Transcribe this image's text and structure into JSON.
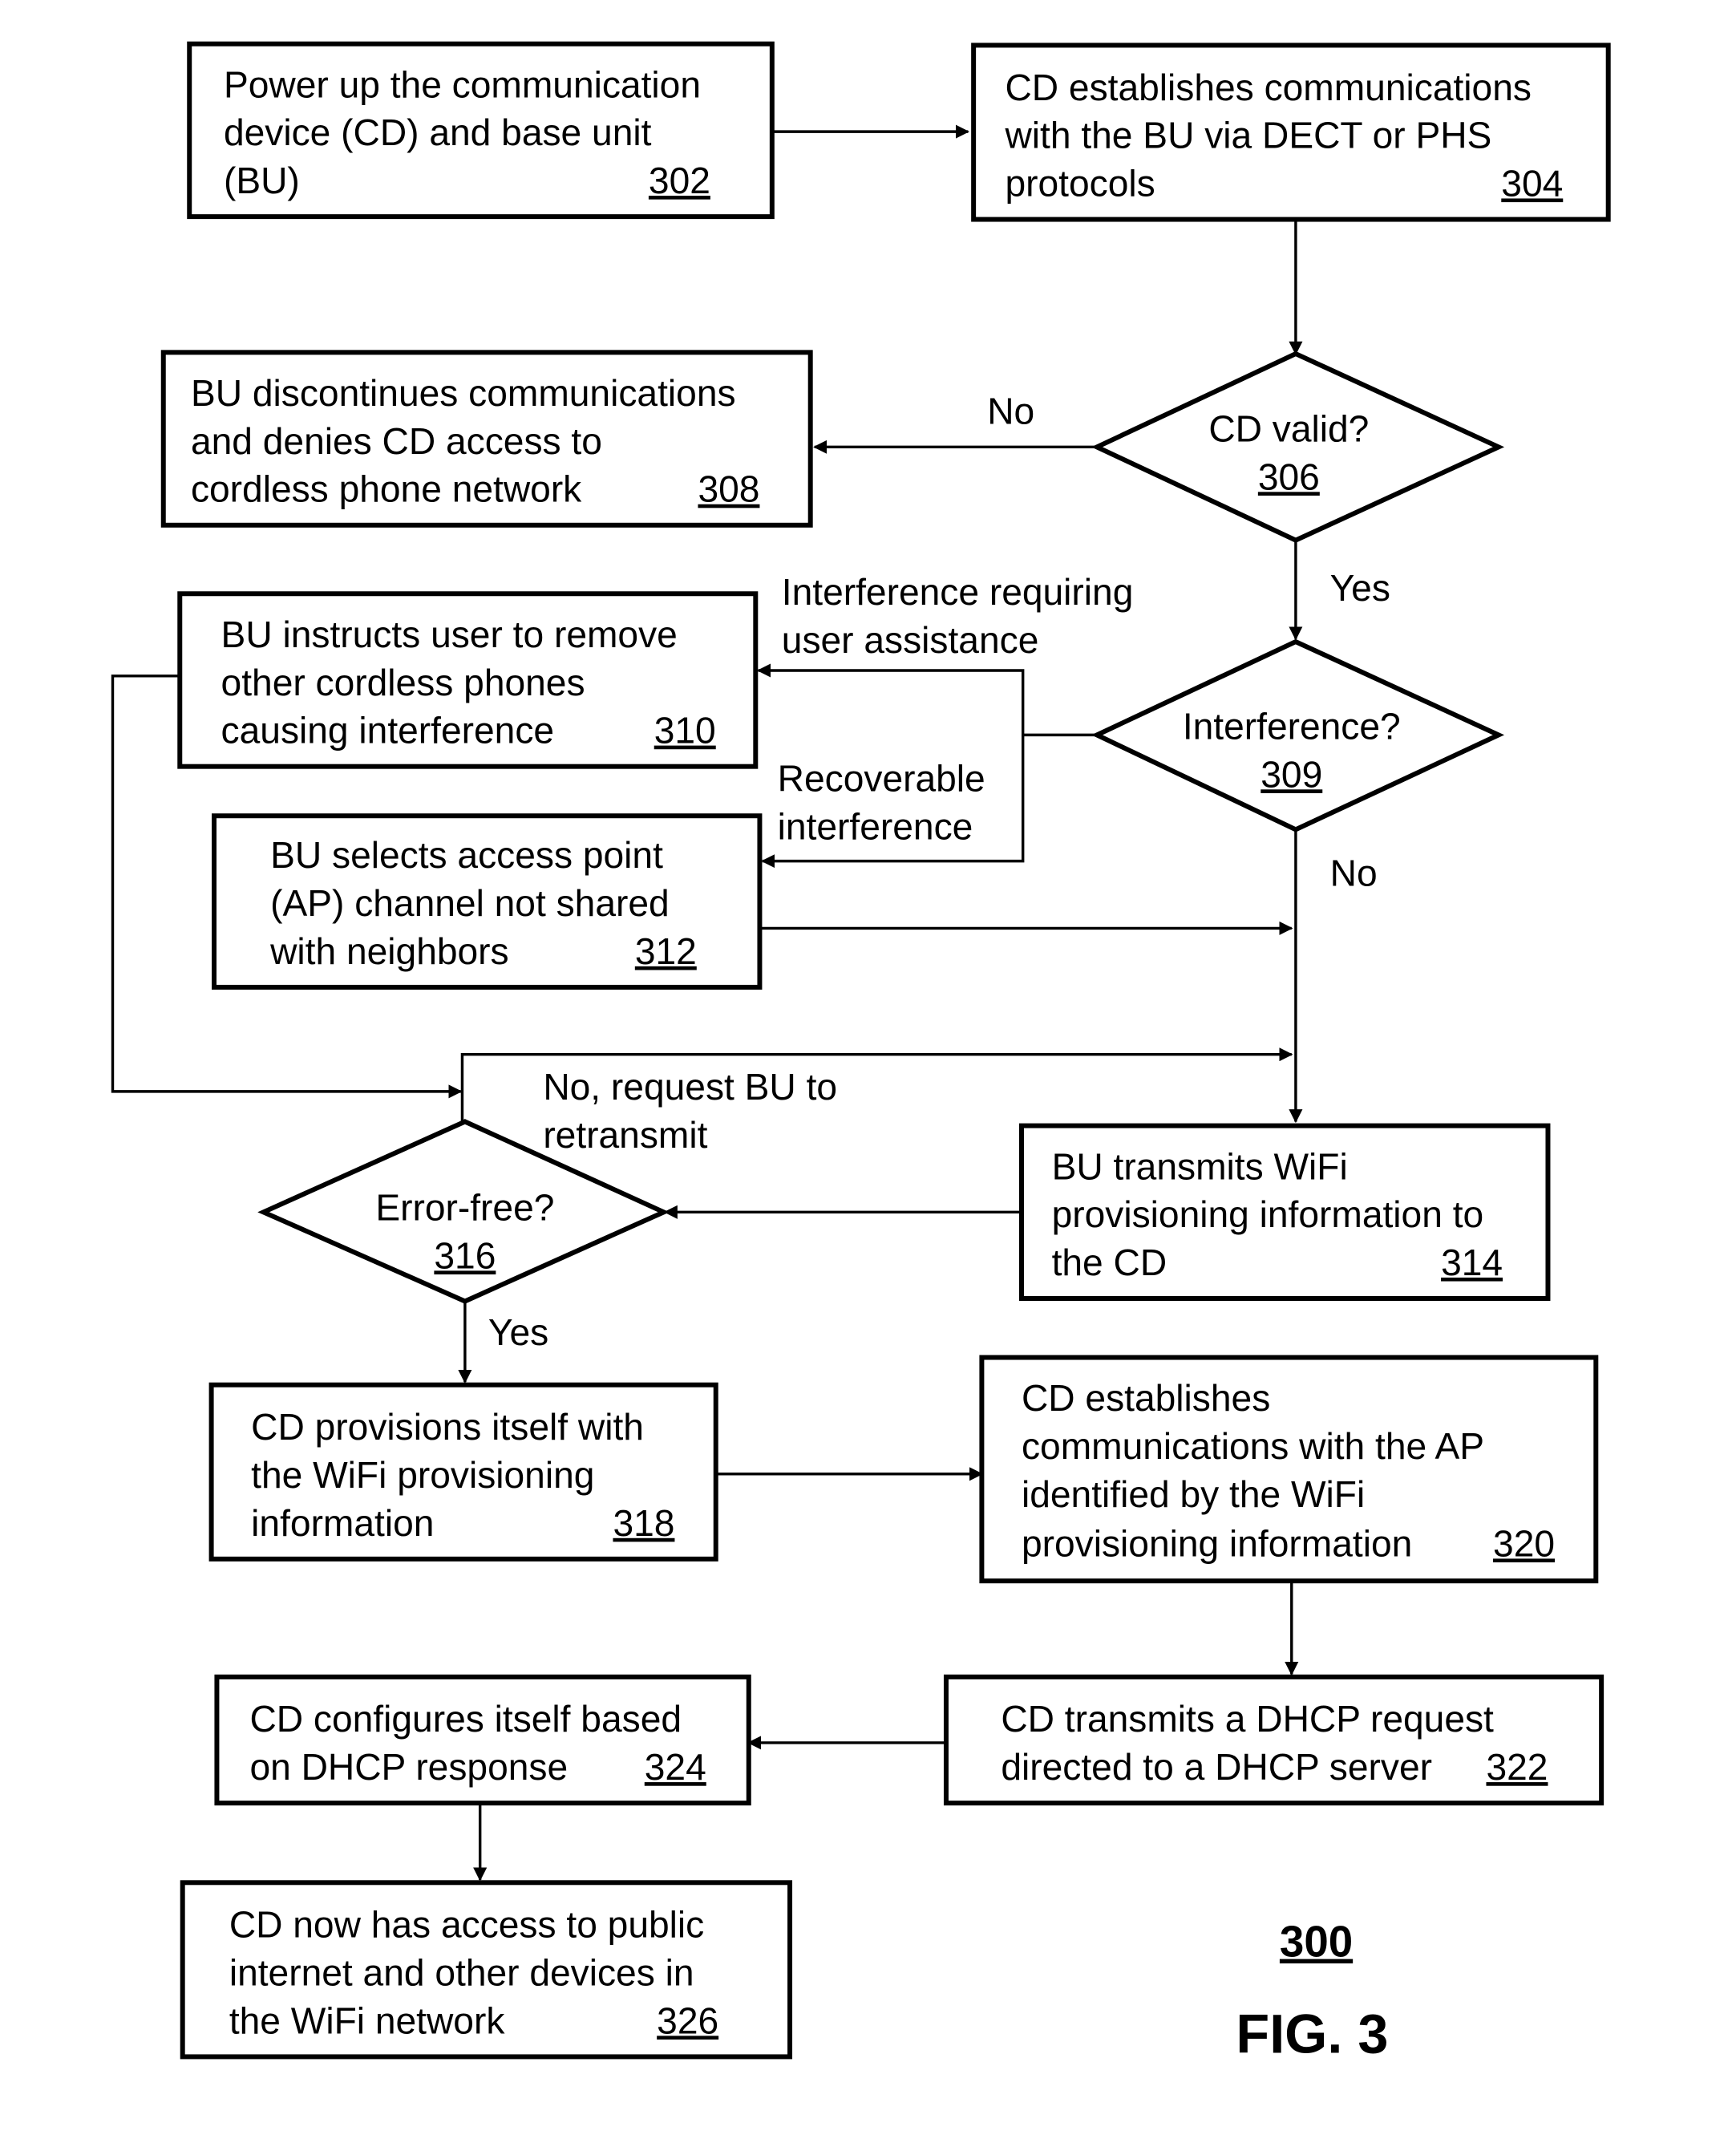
{
  "figure": {
    "number_label": "300",
    "caption": "FIG. 3"
  },
  "steps": {
    "s302": {
      "lines": [
        "Power up the communication",
        "device (CD) and base unit",
        "(BU)"
      ],
      "ref": "302"
    },
    "s304": {
      "lines": [
        "CD establishes communications",
        "with the BU via DECT or PHS",
        "protocols"
      ],
      "ref": "304"
    },
    "s306": {
      "lines": [
        "CD valid?"
      ],
      "ref": "306"
    },
    "s308": {
      "lines": [
        "BU discontinues communications",
        "and denies CD access to",
        "cordless phone network"
      ],
      "ref": "308"
    },
    "s309": {
      "lines": [
        "Interference?"
      ],
      "ref": "309"
    },
    "s310": {
      "lines": [
        "BU instructs user to remove",
        "other cordless phones",
        "causing interference"
      ],
      "ref": "310"
    },
    "s312": {
      "lines": [
        "BU selects access point",
        "(AP) channel not shared",
        "with neighbors"
      ],
      "ref": "312"
    },
    "s314": {
      "lines": [
        "BU transmits WiFi",
        "provisioning information to",
        "the CD"
      ],
      "ref": "314"
    },
    "s316": {
      "lines": [
        "Error-free?"
      ],
      "ref": "316"
    },
    "s318": {
      "lines": [
        "CD provisions itself with",
        "the WiFi provisioning",
        "information"
      ],
      "ref": "318"
    },
    "s320": {
      "lines": [
        "CD establishes",
        "communications with the AP",
        "identified by the WiFi",
        "provisioning information"
      ],
      "ref": "320"
    },
    "s322": {
      "lines": [
        "CD transmits a DHCP request",
        "directed to a DHCP server"
      ],
      "ref": "322"
    },
    "s324": {
      "lines": [
        "CD configures itself based",
        "on DHCP response"
      ],
      "ref": "324"
    },
    "s326": {
      "lines": [
        "CD now has access to public",
        "internet and other devices in",
        "the WiFi network"
      ],
      "ref": "326"
    }
  },
  "edge_labels": {
    "no_306": "No",
    "yes_306": "Yes",
    "user_assist": [
      "Interference requiring",
      "user assistance"
    ],
    "recoverable": [
      "Recoverable",
      "interference"
    ],
    "no_309": "No",
    "retransmit": [
      "No, request BU to",
      "retransmit"
    ],
    "yes_316": "Yes"
  }
}
